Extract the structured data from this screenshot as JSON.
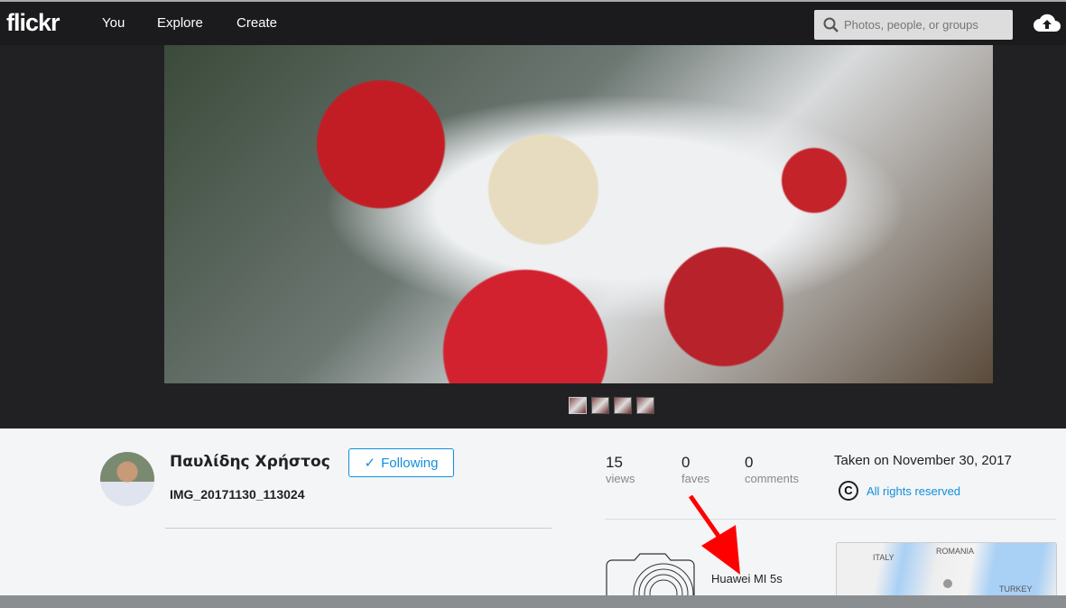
{
  "nav": {
    "logo": "flickr",
    "links": [
      "You",
      "Explore",
      "Create"
    ],
    "search_placeholder": "Photos, people, or groups"
  },
  "photo": {
    "thumbnail_count": 4
  },
  "owner": {
    "name": "Παυλίδης Χρήστος",
    "follow_label": "Following",
    "photo_title": "IMG_20171130_113024"
  },
  "stats": [
    {
      "value": "15",
      "label": "views"
    },
    {
      "value": "0",
      "label": "faves"
    },
    {
      "value": "0",
      "label": "comments"
    }
  ],
  "taken": "Taken on November 30, 2017",
  "license": {
    "icon": "C",
    "label": "All rights reserved"
  },
  "camera": {
    "name": "Huawei MI 5s"
  },
  "map": {
    "labels": [
      "ITALY",
      "ROMANIA",
      "TURKEY"
    ]
  },
  "colors": {
    "accent": "#128fdc",
    "annotation_arrow": "#ff0000"
  }
}
